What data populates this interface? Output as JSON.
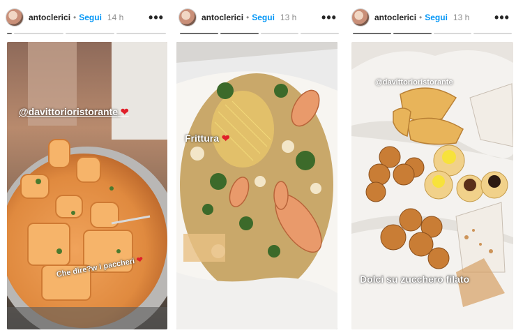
{
  "stories": [
    {
      "username": "antoclerici",
      "separator": "•",
      "follow_label": "Segui",
      "time": "14 h",
      "more": "•••",
      "mention": "@davittorioristorante",
      "heart": "❤",
      "caption": "Che dire?w i pacchericheri",
      "caption_text": "Che dire?w i paccheri",
      "icons": {
        "avatar": "profile-avatar",
        "more": "more-options-icon",
        "heart": "heart-emoji"
      }
    },
    {
      "username": "antoclerici",
      "separator": "•",
      "follow_label": "Segui",
      "time": "13 h",
      "more": "•••",
      "caption": "Frittura",
      "heart": "❤"
    },
    {
      "username": "antoclerici",
      "separator": "•",
      "follow_label": "Segui",
      "time": "13 h",
      "more": "•••",
      "mention": "@davittorioristorante",
      "caption": "Dolci su zucchero filato"
    }
  ],
  "colors": {
    "follow": "#0095f6",
    "heart": "#e0202a",
    "username": "#262626",
    "meta": "#8e8e8e"
  }
}
